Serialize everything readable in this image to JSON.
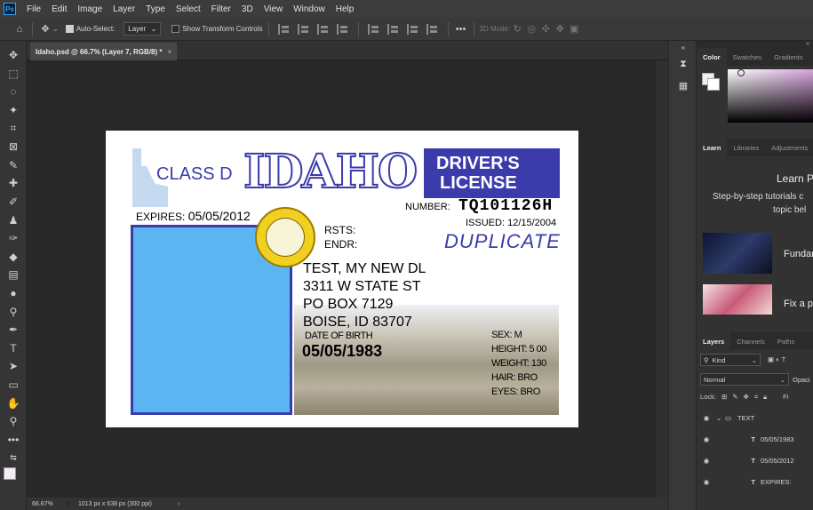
{
  "menubar": {
    "logo": "Ps",
    "items": [
      "File",
      "Edit",
      "Image",
      "Layer",
      "Type",
      "Select",
      "Filter",
      "3D",
      "View",
      "Window",
      "Help"
    ]
  },
  "options": {
    "auto_select": "Auto-Select:",
    "auto_select_target": "Layer",
    "show_transform": "Show Transform Controls",
    "mode_3d": "3D Mode:"
  },
  "document": {
    "tab_title": "Idaho.psd @ 66.7% (Layer 7, RGB/8) *",
    "close": "×"
  },
  "status": {
    "zoom": "66.67%",
    "info": "1013 px x 638 px (300 ppi)",
    "arrow": "›"
  },
  "license": {
    "state": "IDAHO",
    "doc_type_1": "DRIVER'S",
    "doc_type_2": "LICENSE",
    "class": "CLASS D",
    "expires_label": "EXPIRES:",
    "expires_value": "05/05/2012",
    "number_label": "NUMBER:",
    "number_value": "TQ101126H",
    "issued_label": "ISSUED:",
    "issued_value": "12/15/2004",
    "rsts_label": "RSTS:",
    "endr_label": "ENDR:",
    "duplicate": "DUPLICATE",
    "name_line": "TEST, MY NEW DL",
    "addr_line1": "3311 W STATE ST",
    "addr_line2": "PO BOX 7129",
    "addr_line3": "BOISE, ID 83707",
    "dob_label": "DATE OF BIRTH",
    "dob_value": "05/05/1983",
    "sex_label": "SEX:",
    "sex_value": "M",
    "height_label": "HEIGHT:",
    "height_value": "5 00",
    "weight_label": "WEIGHT:",
    "weight_value": "130",
    "hair_label": "HAIR:",
    "hair_value": "BRO",
    "eyes_label": "EYES:",
    "eyes_value": "BRO"
  },
  "panels": {
    "color_tabs": [
      "Color",
      "Swatches",
      "Gradients"
    ],
    "learn_tabs": [
      "Learn",
      "Libraries",
      "Adjustments"
    ],
    "learn_title": "Learn P",
    "learn_sub1": "Step-by-step tutorials c",
    "learn_sub2": "topic bel",
    "tutorial1": "Fundan",
    "tutorial2": "Fix a p",
    "layers_tabs": [
      "Layers",
      "Channels",
      "Paths"
    ],
    "kind": "Kind",
    "blend": "Normal",
    "opacity": "Opaci",
    "lock": "Lock:",
    "fill": "Fi",
    "layers": [
      {
        "name": "TEXT",
        "type": "group"
      },
      {
        "name": "05/05/1983",
        "type": "text"
      },
      {
        "name": "05/05/2012",
        "type": "text"
      },
      {
        "name": "EXPIRES:",
        "type": "text"
      }
    ]
  }
}
